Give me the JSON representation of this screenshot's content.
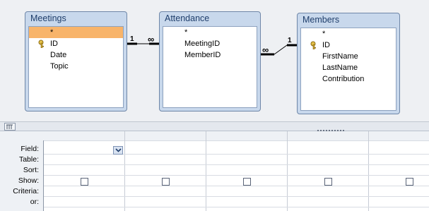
{
  "tables": {
    "meetings": {
      "title": "Meetings",
      "fields": [
        "*",
        "ID",
        "Date",
        "Topic"
      ]
    },
    "attendance": {
      "title": "Attendance",
      "fields": [
        "*",
        "MeetingID",
        "MemberID"
      ]
    },
    "members": {
      "title": "Members",
      "fields": [
        "*",
        "ID",
        "FirstName",
        "LastName",
        "Contribution"
      ]
    }
  },
  "relationships": {
    "r1": {
      "one": "1",
      "many": "∞"
    },
    "r2": {
      "one": "1",
      "many": "∞"
    }
  },
  "grid": {
    "row_labels": [
      "Field:",
      "Table:",
      "Sort:",
      "Show:",
      "Criteria:",
      "or:"
    ]
  },
  "icons": {
    "primary_key": "key-icon",
    "dropdown": "chevron-down-icon",
    "splitter_button": "grid-icon"
  },
  "colors": {
    "selected_field": "#f8b46a",
    "table_frame": "#c8d8ec",
    "table_title": "#1f3e6b"
  }
}
